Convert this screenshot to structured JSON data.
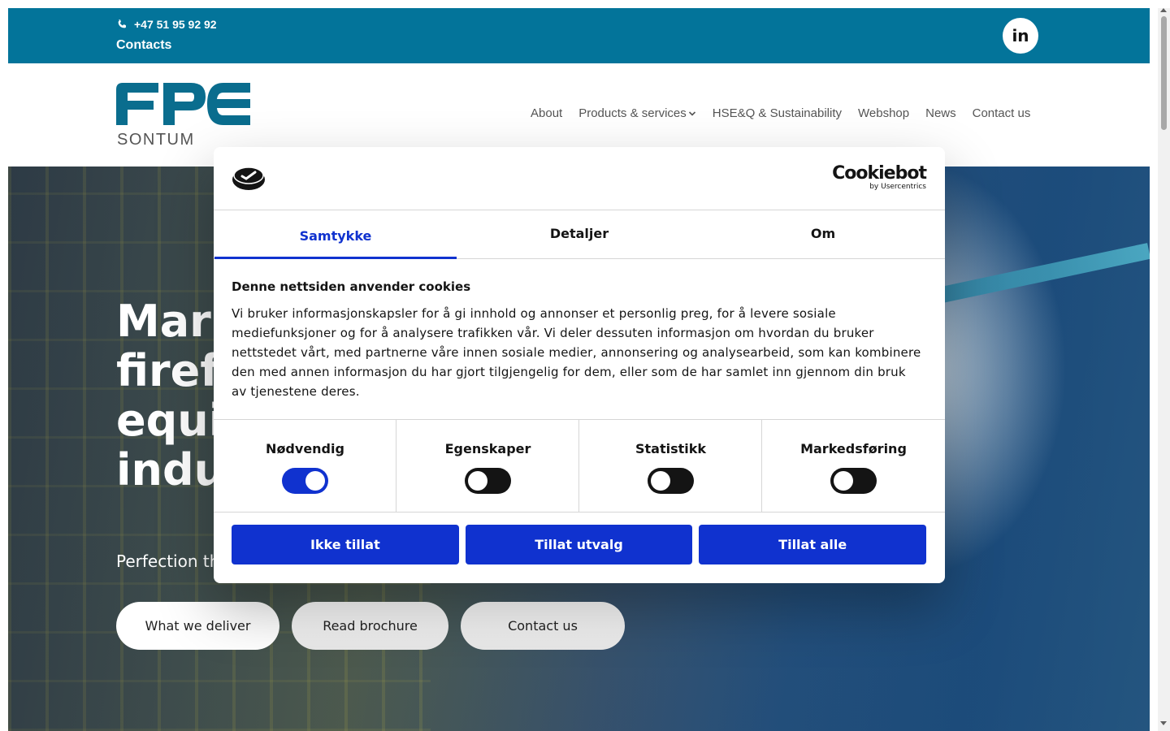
{
  "topbar": {
    "phone": "+47 51 95 92 92",
    "contacts": "Contacts",
    "linkedin": "in"
  },
  "header": {
    "logo_main": "FPE",
    "logo_sub": "SONTUM",
    "nav": [
      "About",
      "Products & services",
      "HSE&Q & Sustainability",
      "Webshop",
      "News",
      "Contact us"
    ]
  },
  "hero": {
    "title_lines": [
      "Mark",
      "firefig",
      "equi",
      "indus"
    ],
    "subtitle": "Perfection th",
    "buttons": [
      "What we deliver",
      "Read brochure",
      "Contact us"
    ]
  },
  "cookie": {
    "brand": "Cookiebot",
    "brand_sub": "by Usercentrics",
    "tabs": [
      "Samtykke",
      "Detaljer",
      "Om"
    ],
    "active_tab": "Samtykke",
    "heading": "Denne nettsiden anvender cookies",
    "text": "Vi bruker informasjonskapsler for å gi innhold og annonser et personlig preg, for å levere sosiale mediefunksjoner og for å analysere trafikken vår. Vi deler dessuten informasjon om hvordan du bruker nettstedet vårt, med partnerne våre innen sosiale medier, annonsering og analysearbeid, som kan kombinere den med annen informasjon du har gjort tilgjengelig for dem, eller som de har samlet inn gjennom din bruk av tjenestene deres.",
    "categories": [
      {
        "label": "Nødvendig",
        "enabled": true
      },
      {
        "label": "Egenskaper",
        "enabled": false
      },
      {
        "label": "Statistikk",
        "enabled": false
      },
      {
        "label": "Markedsføring",
        "enabled": false
      }
    ],
    "buttons": [
      "Ikke tillat",
      "Tillat utvalg",
      "Tillat alle"
    ]
  },
  "colors": {
    "topbar": "#03749a",
    "logo": "#0a6d8e",
    "cookie_accent": "#1032cf"
  }
}
